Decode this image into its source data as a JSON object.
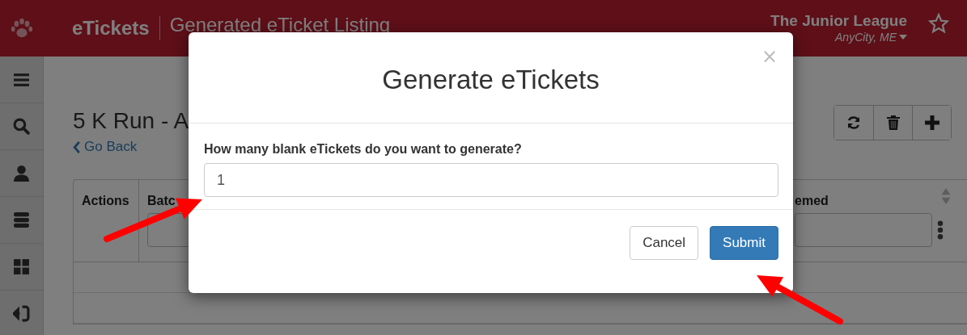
{
  "header": {
    "app_name": "eTickets",
    "page_title": "Generated eTicket Listing",
    "org_name": "The Junior League",
    "org_location": "AnyCity, ME"
  },
  "sidebar": {
    "items": [
      {
        "kind": "menu"
      },
      {
        "kind": "search"
      },
      {
        "kind": "user"
      },
      {
        "kind": "server"
      },
      {
        "kind": "grid"
      },
      {
        "kind": "signin"
      }
    ]
  },
  "page": {
    "title": "5 K Run - A",
    "back_link": "Go Back",
    "toolbar": [
      {
        "kind": "refresh"
      },
      {
        "kind": "delete"
      },
      {
        "kind": "add"
      }
    ]
  },
  "table": {
    "columns": [
      {
        "label": "Actions",
        "filter": false
      },
      {
        "label": "Batc",
        "filter": true
      },
      {
        "label": "emed",
        "filter": true
      }
    ]
  },
  "modal": {
    "title": "Generate eTickets",
    "close": "×",
    "question": "How many blank eTickets do you want to generate?",
    "value": "1",
    "buttons": [
      {
        "label": "Cancel",
        "kind": "default"
      },
      {
        "label": "Submit",
        "kind": "primary"
      }
    ]
  }
}
